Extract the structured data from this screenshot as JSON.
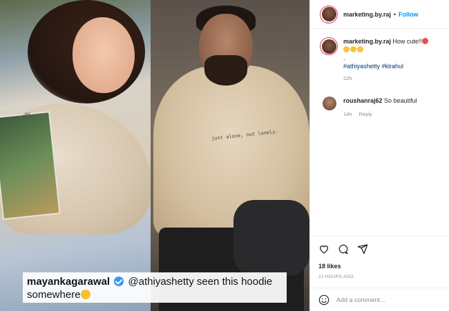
{
  "header": {
    "username": "marketing.by.raj",
    "separator": "•",
    "follow_label": "Follow"
  },
  "caption": {
    "username": "marketing.by.raj",
    "text": "How cute!!",
    "dot": ".",
    "hashtags": "#athiyashetty #klrahul",
    "time": "22h"
  },
  "comments": [
    {
      "username": "roushanraj62",
      "text": "So beautiful",
      "time": "14h",
      "reply_label": "Reply"
    }
  ],
  "actions": {
    "likes": "18 likes",
    "post_time": "22 HOURS AGO",
    "icons": [
      "heart-icon",
      "comment-icon",
      "share-icon"
    ]
  },
  "add_comment": {
    "placeholder": "Add a comment..."
  },
  "image_overlay": {
    "username": "mayankagarawal",
    "mention": "@athiyashetty",
    "line1_rest": "seen this hoodie",
    "line2": "somewhere"
  },
  "hoodie_texts": {
    "left": "elly",
    "right": "just alone, not lonely."
  },
  "colors": {
    "accent_blue": "#0095f6",
    "hashtag": "#00376b",
    "muted": "#8e8e8e",
    "verified": "#3897f0"
  }
}
